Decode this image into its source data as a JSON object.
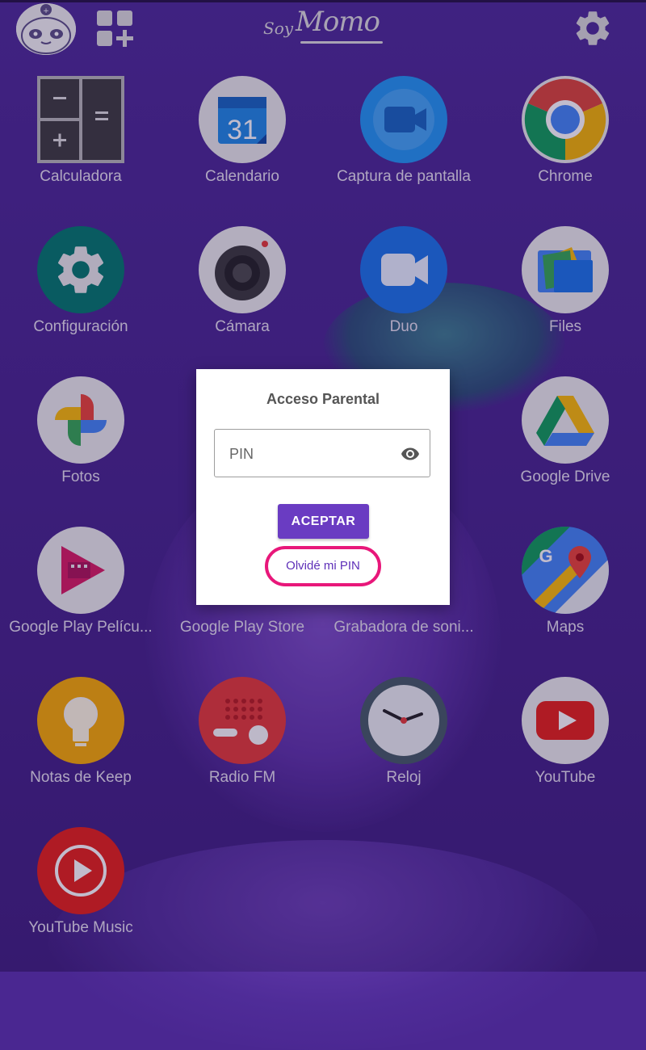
{
  "header": {
    "logo_soy": "Soy",
    "logo_momo": "Momo",
    "avatar_icon": "panda-avatar-icon",
    "widgets_icon": "add-widget-icon",
    "settings_icon": "gear-icon"
  },
  "apps": [
    {
      "label": "Calculadora",
      "icon": "calculator-icon"
    },
    {
      "label": "Calendario",
      "icon": "calendar-icon",
      "badge": "31"
    },
    {
      "label": "Captura de pantalla",
      "icon": "screen-record-icon"
    },
    {
      "label": "Chrome",
      "icon": "chrome-icon"
    },
    {
      "label": "Configuración",
      "icon": "settings-icon"
    },
    {
      "label": "Cámara",
      "icon": "camera-icon"
    },
    {
      "label": "Duo",
      "icon": "duo-icon"
    },
    {
      "label": "Files",
      "icon": "files-icon"
    },
    {
      "label": "Fotos",
      "icon": "photos-icon"
    },
    {
      "label": "Google Drive",
      "icon": "drive-icon"
    },
    {
      "label": "Google Play Pelícu...",
      "icon": "play-movies-icon"
    },
    {
      "label": "Google Play Store",
      "icon": "play-store-icon"
    },
    {
      "label": "Grabadora de soni...",
      "icon": "sound-recorder-icon"
    },
    {
      "label": "Maps",
      "icon": "maps-icon"
    },
    {
      "label": "Notas de Keep",
      "icon": "keep-icon"
    },
    {
      "label": "Radio FM",
      "icon": "radio-icon"
    },
    {
      "label": "Reloj",
      "icon": "clock-icon"
    },
    {
      "label": "YouTube",
      "icon": "youtube-icon"
    },
    {
      "label": "YouTube Music",
      "icon": "youtube-music-icon"
    }
  ],
  "dialog": {
    "title": "Acceso Parental",
    "pin_placeholder": "PIN",
    "pin_value": "",
    "eye_icon": "eye-icon",
    "accept_label": "ACEPTAR",
    "forgot_label": "Olvidé mi PIN"
  },
  "colors": {
    "background": "#4a2791",
    "accent": "#6a3cc2",
    "highlight": "#e8177a"
  }
}
